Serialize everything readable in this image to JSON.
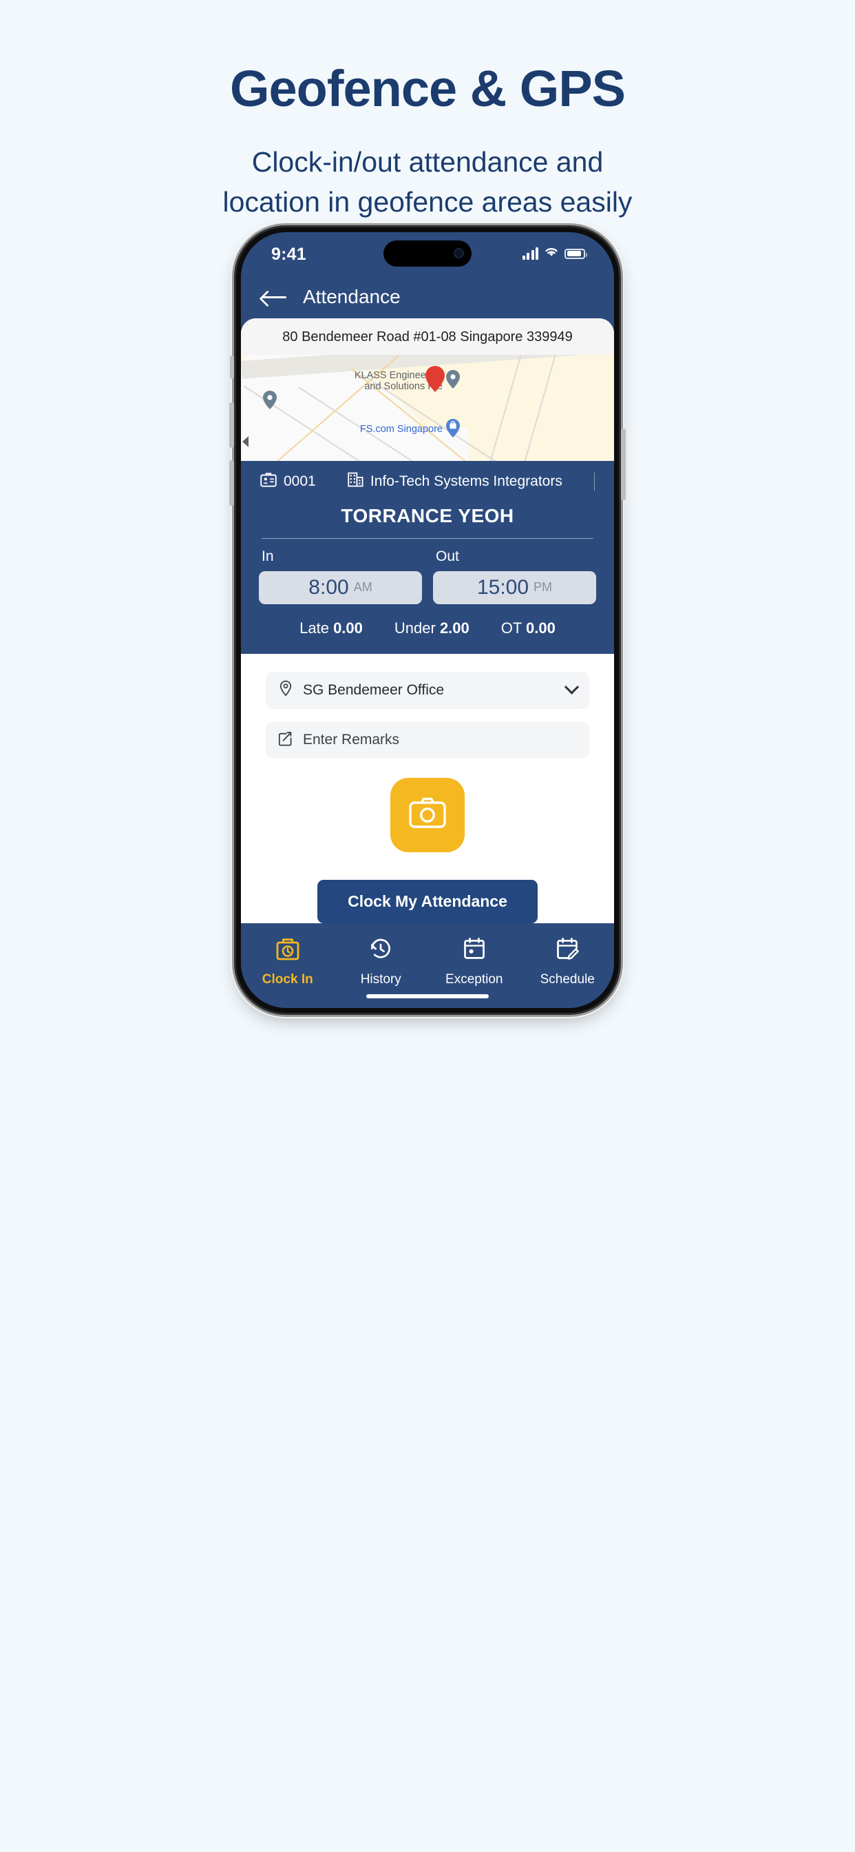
{
  "promo": {
    "title": "Geofence & GPS",
    "subtitle_line1": "Clock-in/out attendance and",
    "subtitle_line2": "location in geofence areas easily",
    "accent_color": "#1c3c6e",
    "background_color": "#f2f8fc"
  },
  "phone": {
    "status_bar": {
      "time": "9:41",
      "signal_icon": "cellular-signal-icon",
      "wifi_icon": "wifi-icon",
      "battery_icon": "battery-icon"
    },
    "app_bar": {
      "back_icon": "back-arrow-icon",
      "title": "Attendance"
    },
    "map": {
      "address": "80 Bendemeer Road #01-08 Singapore 339949",
      "labels": [
        {
          "text_line1": "KLASS Engineering",
          "text_line2": "and Solutions Pte",
          "style": "grey"
        },
        {
          "text_line1": "FS.com Singapore",
          "text_line2": "",
          "style": "blue"
        }
      ],
      "collapse_icon": "collapse-left-arrow-icon",
      "marker_icon": "map-marker-icon"
    },
    "info": {
      "badge_icon": "id-badge-icon",
      "employee_id": "0001",
      "company_icon": "building-icon",
      "company": "Info-Tech Systems Integrators",
      "employee_name": "TORRANCE YEOH",
      "in_label": "In",
      "in_time": "8:00",
      "in_meridiem": "AM",
      "out_label": "Out",
      "out_time": "15:00",
      "out_meridiem": "PM",
      "stats": [
        {
          "label": "Late",
          "value": "0.00"
        },
        {
          "label": "Under",
          "value": "2.00"
        },
        {
          "label": "OT",
          "value": "0.00"
        }
      ]
    },
    "form": {
      "location_icon": "location-pin-icon",
      "location_value": "SG Bendemeer Office",
      "location_chevron_icon": "chevron-down-icon",
      "remarks_icon": "note-edit-icon",
      "remarks_placeholder": "Enter Remarks",
      "camera_icon": "camera-icon",
      "camera_color": "#f5b820",
      "submit_label": "Clock My Attendance",
      "submit_color": "#23477e"
    },
    "tabbar": {
      "items": [
        {
          "label": "Clock In",
          "icon": "clock-in-bag-icon",
          "active": true
        },
        {
          "label": "History",
          "icon": "history-clock-icon",
          "active": false
        },
        {
          "label": "Exception",
          "icon": "calendar-dot-icon",
          "active": false
        },
        {
          "label": "Schedule",
          "icon": "calendar-edit-icon",
          "active": false
        }
      ],
      "active_color": "#f5b820",
      "background_color": "#2c4a7c"
    }
  }
}
